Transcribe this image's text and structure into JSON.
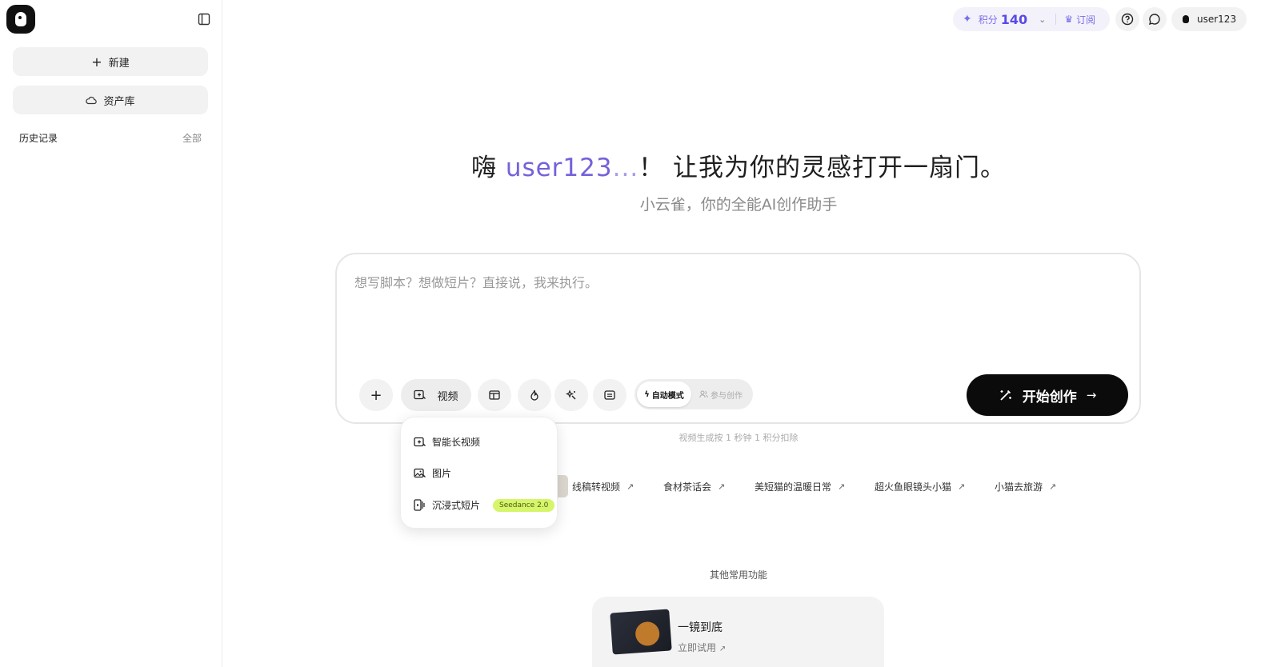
{
  "sidebar": {
    "new_label": "新建",
    "assets_label": "资产库",
    "history_title": "历史记录",
    "history_all": "全部"
  },
  "topbar": {
    "credits_label": "积分",
    "credits_value": "140",
    "subscribe_label": "订阅",
    "username": "user123"
  },
  "hero": {
    "greeting_prefix": "嗨 ",
    "username": "user123",
    "ellipsis": "...",
    "greeting_suffix": "！ 让我为你的灵感打开一扇门。",
    "subtitle": "小云雀，你的全能AI创作助手"
  },
  "prompt": {
    "placeholder": "想写脚本？想做短片？直接说，我来执行。",
    "video_label": "视频",
    "mode_auto": "自动模式",
    "mode_join": "参与创作",
    "start_label": "开始创作",
    "note": "视频生成按 1 秒钟 1 积分扣除"
  },
  "dropdown": {
    "items": [
      {
        "label": "智能长视频"
      },
      {
        "label": "图片"
      },
      {
        "label": "沉浸式短片",
        "badge": "Seedance 2.0"
      }
    ]
  },
  "suggestions": [
    {
      "label": "线稿转视频"
    },
    {
      "label": "食材茶话会"
    },
    {
      "label": "美短猫的温暖日常"
    },
    {
      "label": "超火鱼眼镜头小猫"
    },
    {
      "label": "小猫去旅游"
    }
  ],
  "other": {
    "title": "其他常用功能",
    "card_title": "一镜到底",
    "card_link": "立即试用"
  },
  "colors": {
    "accent": "#7561d9",
    "badge": "#d6f56a",
    "primary_button": "#0b0b0b"
  }
}
